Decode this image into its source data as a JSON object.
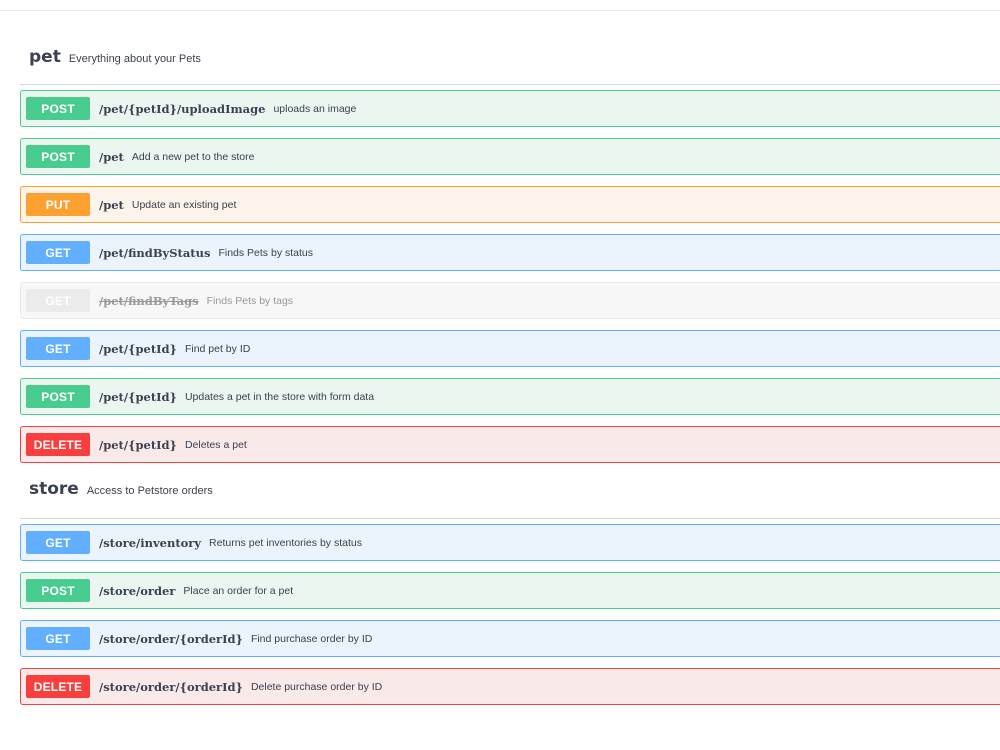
{
  "tags": [
    {
      "name": "pet",
      "description": "Everything about your Pets",
      "operations": [
        {
          "method": "POST",
          "path": "/pet/{petId}/uploadImage",
          "summary": "uploads an image"
        },
        {
          "method": "POST",
          "path": "/pet",
          "summary": "Add a new pet to the store"
        },
        {
          "method": "PUT",
          "path": "/pet",
          "summary": "Update an existing pet"
        },
        {
          "method": "GET",
          "path": "/pet/findByStatus",
          "summary": "Finds Pets by status"
        },
        {
          "method": "GET",
          "path": "/pet/findByTags",
          "summary": "Finds Pets by tags",
          "deprecated": true
        },
        {
          "method": "GET",
          "path": "/pet/{petId}",
          "summary": "Find pet by ID"
        },
        {
          "method": "POST",
          "path": "/pet/{petId}",
          "summary": "Updates a pet in the store with form data"
        },
        {
          "method": "DELETE",
          "path": "/pet/{petId}",
          "summary": "Deletes a pet"
        }
      ]
    },
    {
      "name": "store",
      "description": "Access to Petstore orders",
      "operations": [
        {
          "method": "GET",
          "path": "/store/inventory",
          "summary": "Returns pet inventories by status"
        },
        {
          "method": "POST",
          "path": "/store/order",
          "summary": "Place an order for a pet"
        },
        {
          "method": "GET",
          "path": "/store/order/{orderId}",
          "summary": "Find purchase order by ID"
        },
        {
          "method": "DELETE",
          "path": "/store/order/{orderId}",
          "summary": "Delete purchase order by ID"
        }
      ]
    }
  ],
  "colors": {
    "post": "#49cc90",
    "put": "#fca130",
    "get": "#61affe",
    "delete": "#f93e3e",
    "deprecated": "#ebebeb"
  }
}
